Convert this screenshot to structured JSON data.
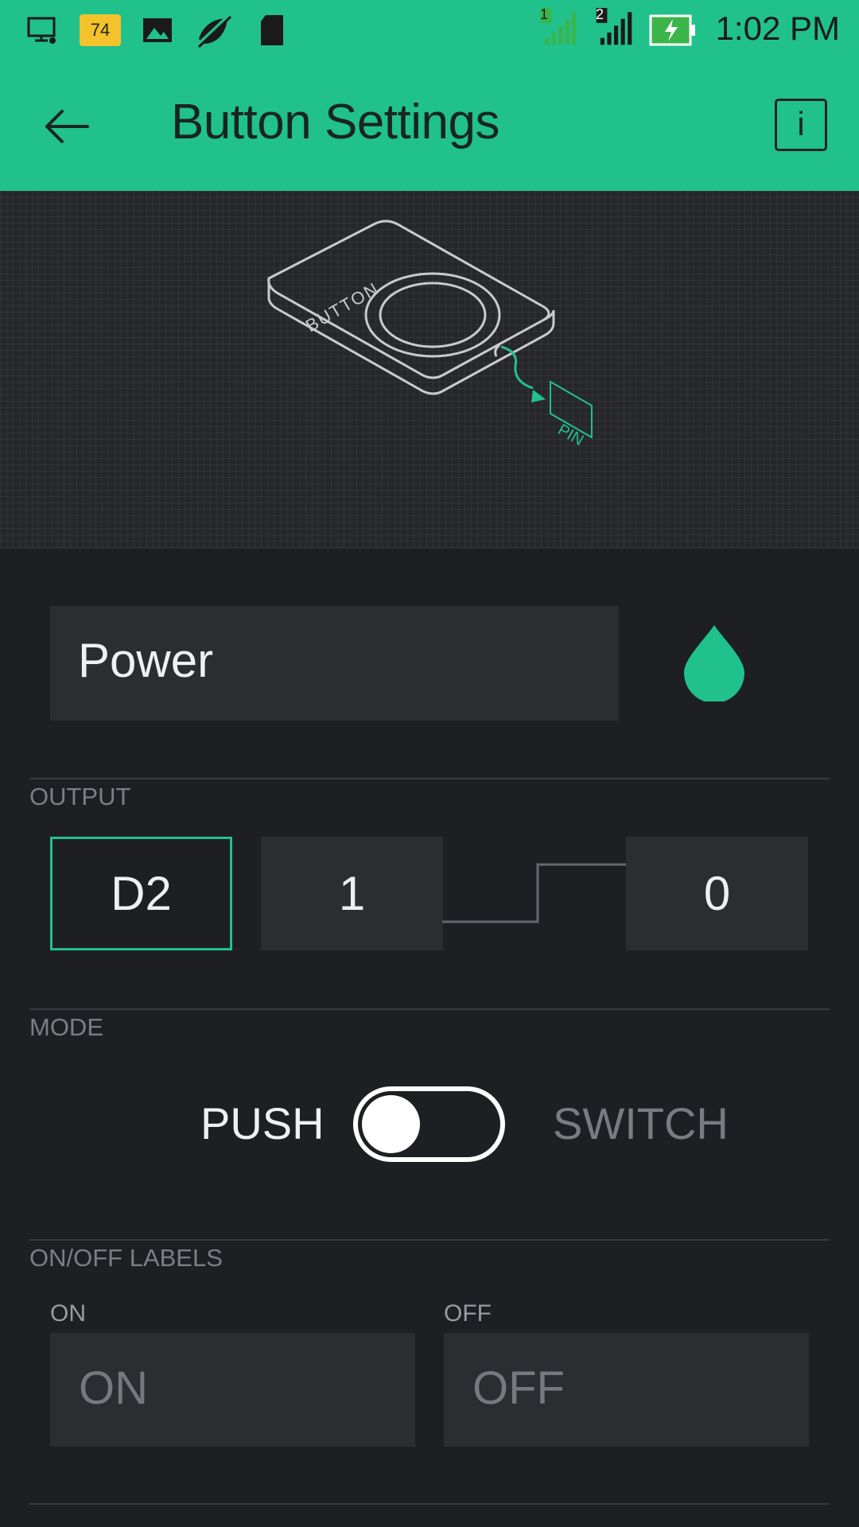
{
  "status_bar": {
    "time": "1:02 PM",
    "notification_badge": "74",
    "sim1_label": "1",
    "sim2_label": "2",
    "icons": [
      "screen-cast-icon",
      "notification-badge-icon",
      "gallery-icon",
      "mute-icon",
      "sd-card-icon",
      "signal-sim1-icon",
      "signal-sim2-icon",
      "battery-charging-icon"
    ]
  },
  "appbar": {
    "title": "Button Settings",
    "info_label": "i"
  },
  "illustration": {
    "device_label": "BUTTON",
    "pin_label": "PIN"
  },
  "name_field": {
    "value": "Power"
  },
  "output": {
    "section_label": "OUTPUT",
    "pin": "D2",
    "high_value": "1",
    "low_value": "0"
  },
  "mode": {
    "section_label": "MODE",
    "push_label": "PUSH",
    "switch_label": "SWITCH",
    "selected": "PUSH"
  },
  "labels": {
    "section_label": "ON/OFF LABELS",
    "on_caption": "ON",
    "off_caption": "OFF",
    "on_placeholder": "ON",
    "off_placeholder": "OFF"
  },
  "colors": {
    "accent": "#21c18c",
    "background": "#1e1f23",
    "field": "#2c2d31"
  }
}
